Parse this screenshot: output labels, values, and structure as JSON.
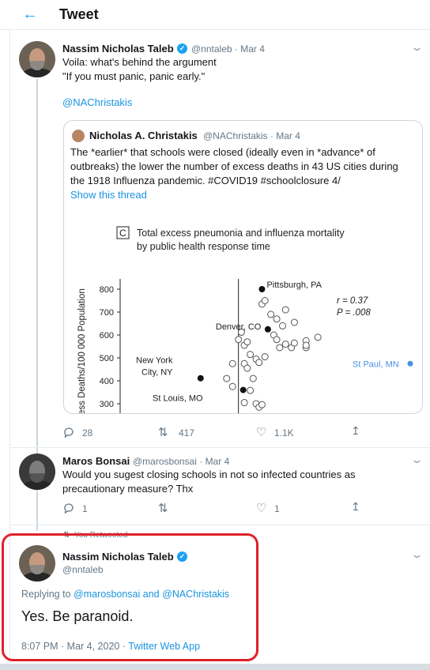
{
  "header": {
    "back_icon": "arrow-left-icon",
    "title": "Tweet"
  },
  "tweet1": {
    "name": "Nassim Nicholas Taleb",
    "handle": "@nntaleb",
    "date": "Mar 4",
    "line1": "Voila: what's behind the argument",
    "line2": "\"If you must panic, panic early.\"",
    "mention": "@NAChristakis",
    "quote": {
      "name": "Nicholas A. Christakis",
      "handle": "@NAChristakis",
      "date": "Mar 4",
      "line1": "The *earlier* that schools were closed (ideally even in *advance* of",
      "line2": "outbreaks) the lower the number of excess deaths in 43 US cities during",
      "line3": "the 1918 Influenza pandemic. #COVID19 #schoolclosure 4/",
      "show_thread": "Show this thread"
    },
    "stats": {
      "replies": "28",
      "retweets": "417",
      "likes": "1.1K"
    }
  },
  "tweet2": {
    "name": "Maros Bonsai",
    "handle": "@marosbonsai",
    "date": "Mar 4",
    "line1": "Would you sugest closing schools in not so infected countries as",
    "line2": "precautionary measure? Thx",
    "stats": {
      "replies": "1",
      "retweets": "",
      "likes": "1"
    }
  },
  "tweet3": {
    "retweeted_label": "You Retweeted",
    "name": "Nassim Nicholas Taleb",
    "handle": "@nntaleb",
    "replying_prefix": "Replying to",
    "reply_user1": "@marosbonsai",
    "reply_and": "and",
    "reply_user2": "@NAChristakis",
    "text": "Yes. Be paranoid.",
    "time": "8:07 PM · Mar 4, 2020 ·",
    "source": "Twitter Web App"
  },
  "chart_data": {
    "type": "scatter",
    "panel_letter": "C",
    "title_line1": "Total excess pneumonia and influenza mortality",
    "title_line2": "by public health response time",
    "ylabel": "ess Deaths/100 000 Population",
    "ylim": [
      290,
      830
    ],
    "yticks": [
      "800",
      "700",
      "600",
      "500",
      "400",
      "300"
    ],
    "ytick_values": [
      800,
      700,
      600,
      500,
      400,
      300
    ],
    "xlim": [
      -12,
      60
    ],
    "vline_x": 0,
    "stats_r": "r = 0.37",
    "stats_p": "P = .008",
    "labeled_points": [
      {
        "label": "Pittsburgh, PA",
        "x": 8,
        "y": 800
      },
      {
        "label": "Denver, CO",
        "x": 10,
        "y": 625
      },
      {
        "label": "New York",
        "x": -13,
        "y": 470
      },
      {
        "label": "City, NY",
        "x": -13,
        "y": 450
      },
      {
        "label": "St Louis, MO",
        "x": 0,
        "y": 360
      }
    ],
    "highlight_point": {
      "label": "St Paul, MN",
      "x": 60,
      "y": 475
    },
    "points": [
      {
        "x": 8,
        "y": 735
      },
      {
        "x": 9,
        "y": 750
      },
      {
        "x": 11,
        "y": 690
      },
      {
        "x": 13,
        "y": 670
      },
      {
        "x": 15,
        "y": 640
      },
      {
        "x": 16,
        "y": 710
      },
      {
        "x": 19,
        "y": 655
      },
      {
        "x": 12,
        "y": 600
      },
      {
        "x": 13,
        "y": 580
      },
      {
        "x": 16,
        "y": 560
      },
      {
        "x": 14,
        "y": 545
      },
      {
        "x": 18,
        "y": 545
      },
      {
        "x": 19,
        "y": 565
      },
      {
        "x": 23,
        "y": 575
      },
      {
        "x": 23,
        "y": 545
      },
      {
        "x": 27,
        "y": 590
      },
      {
        "x": 1,
        "y": 612
      },
      {
        "x": 0,
        "y": 580
      },
      {
        "x": 2,
        "y": 555
      },
      {
        "x": 3,
        "y": 570
      },
      {
        "x": 4,
        "y": 515
      },
      {
        "x": 6,
        "y": 495
      },
      {
        "x": 7,
        "y": 480
      },
      {
        "x": 9,
        "y": 505
      },
      {
        "x": 2,
        "y": 475
      },
      {
        "x": 3,
        "y": 455
      },
      {
        "x": -2,
        "y": 475
      },
      {
        "x": -4,
        "y": 410
      },
      {
        "x": -2,
        "y": 375
      },
      {
        "x": 5,
        "y": 410
      },
      {
        "x": 4,
        "y": 358
      },
      {
        "x": 2,
        "y": 305
      },
      {
        "x": 6,
        "y": 300
      },
      {
        "x": 7,
        "y": 285
      },
      {
        "x": 8,
        "y": 296
      },
      {
        "x": 23,
        "y": 555
      }
    ]
  }
}
